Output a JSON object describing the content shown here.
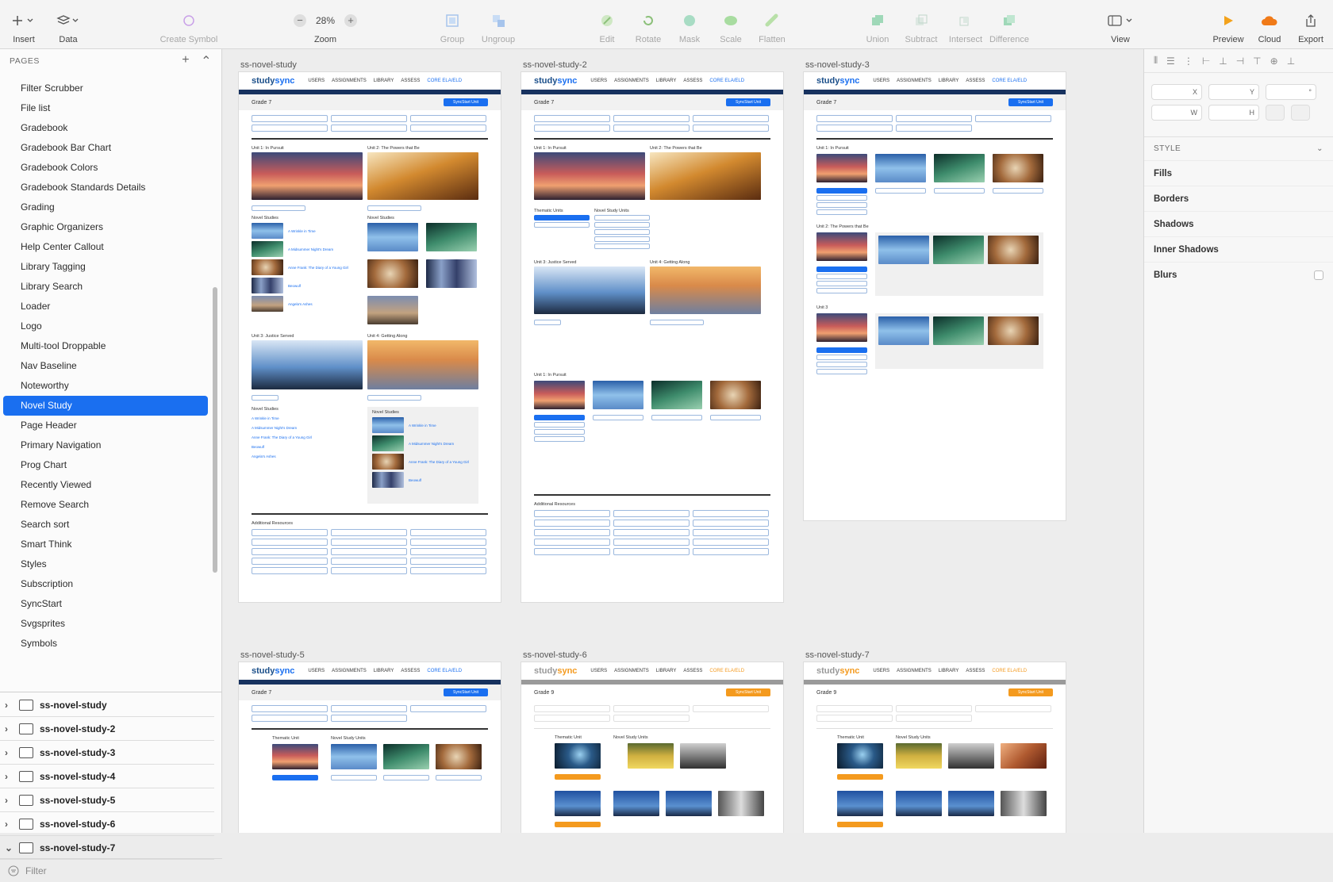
{
  "toolbar": {
    "insert": "Insert",
    "data": "Data",
    "create_symbol": "Create Symbol",
    "zoom_value": "28%",
    "zoom": "Zoom",
    "group": "Group",
    "ungroup": "Ungroup",
    "edit": "Edit",
    "rotate": "Rotate",
    "mask": "Mask",
    "scale": "Scale",
    "flatten": "Flatten",
    "union": "Union",
    "subtract": "Subtract",
    "intersect": "Intersect",
    "difference": "Difference",
    "view": "View",
    "preview": "Preview",
    "cloud": "Cloud",
    "export": "Export"
  },
  "pages": {
    "title": "PAGES",
    "items": [
      "Filter Scrubber",
      "File list",
      "Gradebook",
      "Gradebook Bar Chart",
      "Gradebook Colors",
      "Gradebook Standards Details",
      "Grading",
      "Graphic Organizers",
      "Help Center Callout",
      "Library Tagging",
      "Library Search",
      "Loader",
      "Logo",
      "Multi-tool Droppable",
      "Nav Baseline",
      "Noteworthy",
      "Novel Study",
      "Page Header",
      "Primary Navigation",
      "Prog Chart",
      "Recently Viewed",
      "Remove Search",
      "Search sort",
      "Smart Think",
      "Styles",
      "Subscription",
      "SyncStart",
      "Svgsprites",
      "Symbols"
    ],
    "selected": "Novel Study"
  },
  "artboard_list": [
    "ss-novel-study",
    "ss-novel-study-2",
    "ss-novel-study-3",
    "ss-novel-study-4",
    "ss-novel-study-5",
    "ss-novel-study-6",
    "ss-novel-study-7"
  ],
  "filter_placeholder": "Filter",
  "canvas": {
    "boards": [
      "ss-novel-study",
      "ss-novel-study-2",
      "ss-novel-study-3",
      "ss-novel-study-5",
      "ss-novel-study-6",
      "ss-novel-study-7"
    ],
    "brand_a": "study",
    "brand_b": "sync",
    "nav": [
      "USERS",
      "ASSIGNMENTS",
      "LIBRARY",
      "ASSESS",
      "CORE ELA/ELD"
    ],
    "grade7": "Grade 7",
    "grade9": "Grade 9",
    "btn": "SyncStart Unit",
    "unit1": "Unit 1: In Pursuit",
    "unit2": "Unit 2: The Powers that Be",
    "unit3": "Unit 3: Justice Served",
    "unit4": "Unit 4: Getting Along",
    "novel_studies": "Novel Studies",
    "novel_study_units": "Novel Study Units",
    "thematic_unit": "Thematic Unit",
    "thematic_units": "Thematic Units",
    "additional": "Additional Resources",
    "unit3_short": "Unit 3",
    "titles": [
      "A Wrinkle in Time",
      "A Midsummer Night's Dream",
      "Anne Frank: The Diary of a Young Girl",
      "Beowulf",
      "Angela's Ashes"
    ]
  },
  "inspector": {
    "x": "X",
    "y": "Y",
    "deg": "°",
    "w": "W",
    "h": "H",
    "style": "STYLE",
    "fills": "Fills",
    "borders": "Borders",
    "shadows": "Shadows",
    "inner_shadows": "Inner Shadows",
    "blurs": "Blurs"
  }
}
